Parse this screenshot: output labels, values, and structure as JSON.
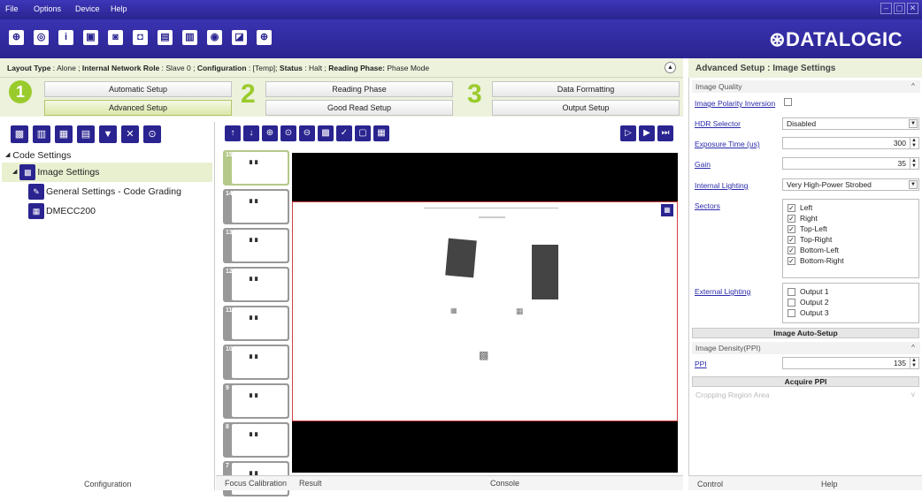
{
  "menu": [
    "File",
    "Options",
    "Device",
    "Help"
  ],
  "window_buttons": [
    "minimize",
    "restore",
    "close"
  ],
  "toolbar_icons": [
    "connect-icon",
    "device-icon",
    "info-icon",
    "window-icon",
    "camera-icon",
    "camera-settings-icon",
    "save-icon",
    "load-icon",
    "capture-icon",
    "io-icon",
    "target-icon"
  ],
  "logo": "⊛DATALOGIC",
  "status": {
    "layout_type_label": "Layout Type",
    "layout_type": "Alone",
    "network_role_label": "Internal Network Role",
    "network_role": "Slave 0",
    "configuration_label": "Configuration",
    "configuration": "[Temp]",
    "status_label": "Status",
    "status": "Halt",
    "phase_label": "Reading Phase:",
    "phase": "Phase Mode"
  },
  "wizard": {
    "step1": "1",
    "step2": "2",
    "step3": "3",
    "automatic_setup": "Automatic Setup",
    "advanced_setup": "Advanced Setup",
    "reading_phase": "Reading Phase",
    "good_read_setup": "Good Read Setup",
    "data_formatting": "Data Formatting",
    "output_setup": "Output Setup"
  },
  "tree": {
    "root": "Code Settings",
    "items": [
      "Image Settings",
      "General Settings - Code Grading",
      "DMECC200"
    ]
  },
  "thumbnails": [
    "15",
    "14",
    "13",
    "12",
    "11",
    "10",
    "9",
    "8",
    "7"
  ],
  "bottom_tabs": {
    "configuration": "Configuration",
    "focus_calibration": "Focus Calibration",
    "result": "Result",
    "console": "Console",
    "control": "Control",
    "help": "Help"
  },
  "right": {
    "title": "Advanced Setup : Image Settings",
    "image_quality": "Image Quality",
    "image_polarity_inversion": "Image Polarity Inversion",
    "hdr_selector": "HDR Selector",
    "hdr_value": "Disabled",
    "exposure_time": "Exposure Time (us)",
    "exposure_value": "300",
    "gain": "Gain",
    "gain_value": "35",
    "internal_lighting": "Internal Lighting",
    "internal_lighting_value": "Very High-Power Strobed",
    "sectors": "Sectors",
    "sector_items": [
      "Left",
      "Right",
      "Top-Left",
      "Top-Right",
      "Bottom-Left",
      "Bottom-Right"
    ],
    "external_lighting": "External Lighting",
    "external_items": [
      "Output 1",
      "Output 2",
      "Output 3"
    ],
    "image_auto_setup": "Image Auto-Setup",
    "image_density": "Image Density(PPI)",
    "ppi": "PPI",
    "ppi_value": "135",
    "acquire_ppi": "Acquire PPI",
    "cropping_region": "Cropping Region Area"
  }
}
